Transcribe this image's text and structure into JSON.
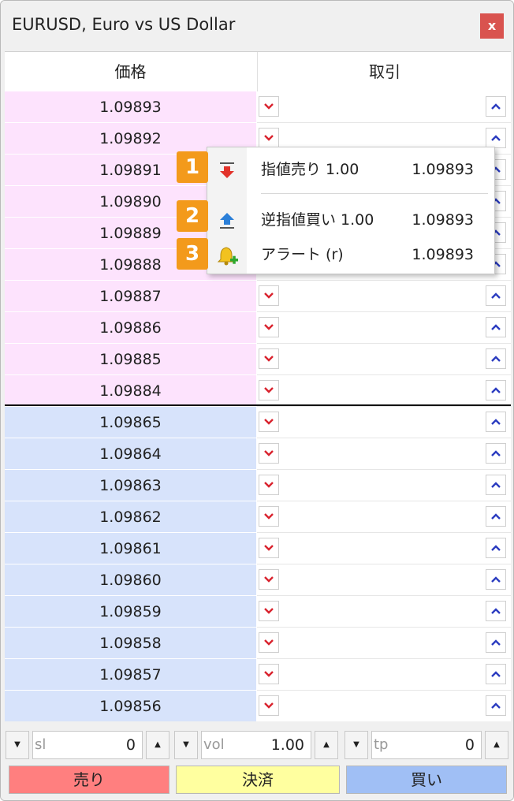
{
  "window": {
    "title": "EURUSD, Euro vs US Dollar",
    "close_label": "x"
  },
  "header": {
    "price": "価格",
    "trade": "取引"
  },
  "icons": {
    "sell": "chevron-down-icon",
    "buy": "chevron-up-icon",
    "sell_limit": "arrow-down-icon",
    "buy_stop": "arrow-up-icon",
    "alert": "bell-plus-icon"
  },
  "colors": {
    "ask_bg": "#fde3fd",
    "bid_bg": "#d7e3fb",
    "sell_btn": "#ff7f7f",
    "close_btn": "#ffff9f",
    "buy_btn": "#a0bff5",
    "badge": "#f39a1b",
    "sell_arrow": "#d9232e",
    "buy_arrow": "#2b3cc0"
  },
  "ask_prices": [
    "1.09893",
    "1.09892",
    "1.09891",
    "1.09890",
    "1.09889",
    "1.09888",
    "1.09887",
    "1.09886",
    "1.09885",
    "1.09884"
  ],
  "bid_prices": [
    "1.09865",
    "1.09864",
    "1.09863",
    "1.09862",
    "1.09861",
    "1.09860",
    "1.09859",
    "1.09858",
    "1.09857",
    "1.09856"
  ],
  "context_menu": {
    "items": [
      {
        "badge": "1",
        "label": "指値売り 1.00",
        "price": "1.09893"
      },
      {
        "badge": "2",
        "label": "逆指値買い 1.00",
        "price": "1.09893"
      },
      {
        "badge": "3",
        "label": "アラート (r)",
        "price": "1.09893"
      }
    ]
  },
  "controls": {
    "sl": {
      "placeholder": "sl",
      "value": "0"
    },
    "vol": {
      "placeholder": "vol",
      "value": "1.00"
    },
    "tp": {
      "placeholder": "tp",
      "value": "0"
    },
    "sell_label": "売り",
    "close_label": "決済",
    "buy_label": "買い"
  }
}
